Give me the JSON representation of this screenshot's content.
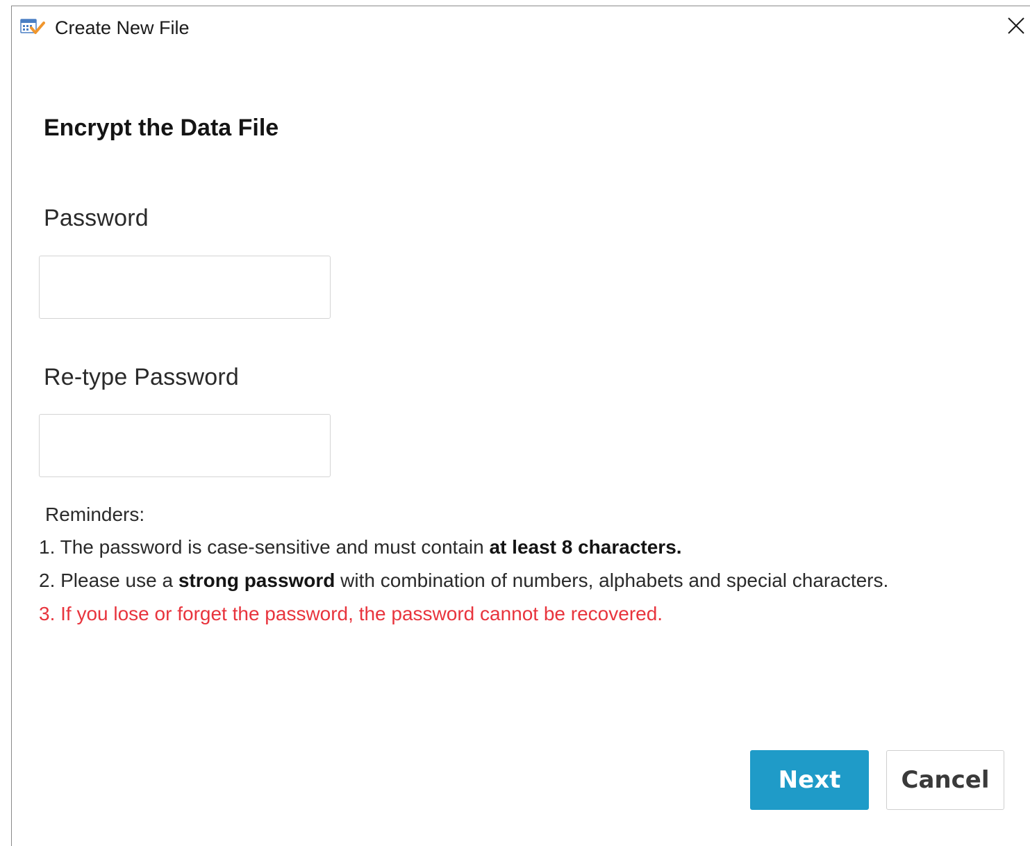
{
  "window": {
    "title": "Create New File",
    "app_icon": "calendar-check-icon",
    "close_icon": "close-icon"
  },
  "form": {
    "heading": "Encrypt the Data File",
    "password_label": "Password",
    "password_value": "",
    "retype_label": "Re-type Password",
    "retype_value": ""
  },
  "reminders": {
    "title": "Reminders:",
    "line1_prefix": "1. The password is case-sensitive and must contain ",
    "line1_bold": "at least 8 characters.",
    "line2_prefix": "2. Please use a ",
    "line2_bold": "strong password",
    "line2_suffix": " with combination of numbers, alphabets and special characters.",
    "line3": "3. If you lose or forget the password, the password cannot be recovered."
  },
  "buttons": {
    "next_label": "Next",
    "cancel_label": "Cancel"
  },
  "colors": {
    "accent": "#1f9bc8",
    "warning": "#e8343d"
  }
}
